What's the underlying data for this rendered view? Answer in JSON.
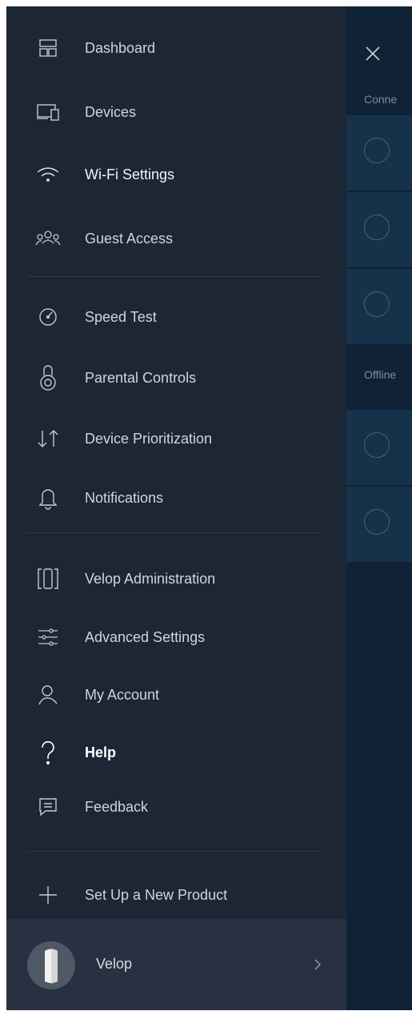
{
  "menu": {
    "items": [
      {
        "label": "Dashboard",
        "icon": "dashboard-icon"
      },
      {
        "label": "Devices",
        "icon": "devices-icon"
      },
      {
        "label": "Wi-Fi Settings",
        "icon": "wifi-icon"
      },
      {
        "label": "Guest Access",
        "icon": "guest-access-icon"
      },
      {
        "label": "Speed Test",
        "icon": "speedometer-icon"
      },
      {
        "label": "Parental Controls",
        "icon": "lock-icon"
      },
      {
        "label": "Device Prioritization",
        "icon": "priority-arrows-icon"
      },
      {
        "label": "Notifications",
        "icon": "bell-icon"
      },
      {
        "label": "Velop Administration",
        "icon": "velop-node-icon"
      },
      {
        "label": "Advanced Settings",
        "icon": "sliders-icon"
      },
      {
        "label": "My Account",
        "icon": "user-icon"
      },
      {
        "label": "Help",
        "icon": "question-icon"
      },
      {
        "label": "Feedback",
        "icon": "chat-bubble-icon"
      },
      {
        "label": "Set Up a New Product",
        "icon": "plus-icon"
      }
    ]
  },
  "footer": {
    "label": "Velop",
    "icon": "chevron-right-icon"
  },
  "background_panel": {
    "close_icon": "close-icon",
    "connected_header": "Conne",
    "offline_header": "Offline"
  },
  "colors": {
    "drawer_bg": "#1c2635",
    "footer_bg": "#273142",
    "panel_bg": "#0f2236",
    "row_bg": "#16324a",
    "text": "#cfd5dc"
  }
}
